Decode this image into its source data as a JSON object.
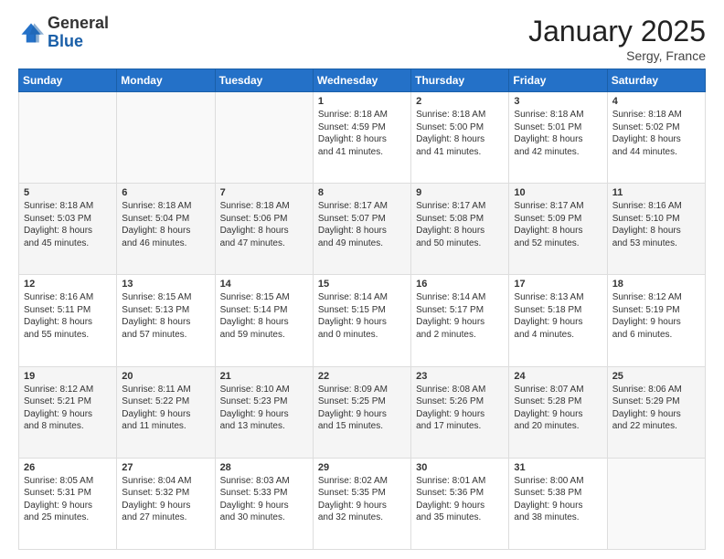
{
  "logo": {
    "general": "General",
    "blue": "Blue"
  },
  "header": {
    "month": "January 2025",
    "location": "Sergy, France"
  },
  "weekdays": [
    "Sunday",
    "Monday",
    "Tuesday",
    "Wednesday",
    "Thursday",
    "Friday",
    "Saturday"
  ],
  "weeks": [
    [
      {
        "day": "",
        "info": ""
      },
      {
        "day": "",
        "info": ""
      },
      {
        "day": "",
        "info": ""
      },
      {
        "day": "1",
        "info": "Sunrise: 8:18 AM\nSunset: 4:59 PM\nDaylight: 8 hours\nand 41 minutes."
      },
      {
        "day": "2",
        "info": "Sunrise: 8:18 AM\nSunset: 5:00 PM\nDaylight: 8 hours\nand 41 minutes."
      },
      {
        "day": "3",
        "info": "Sunrise: 8:18 AM\nSunset: 5:01 PM\nDaylight: 8 hours\nand 42 minutes."
      },
      {
        "day": "4",
        "info": "Sunrise: 8:18 AM\nSunset: 5:02 PM\nDaylight: 8 hours\nand 44 minutes."
      }
    ],
    [
      {
        "day": "5",
        "info": "Sunrise: 8:18 AM\nSunset: 5:03 PM\nDaylight: 8 hours\nand 45 minutes."
      },
      {
        "day": "6",
        "info": "Sunrise: 8:18 AM\nSunset: 5:04 PM\nDaylight: 8 hours\nand 46 minutes."
      },
      {
        "day": "7",
        "info": "Sunrise: 8:18 AM\nSunset: 5:06 PM\nDaylight: 8 hours\nand 47 minutes."
      },
      {
        "day": "8",
        "info": "Sunrise: 8:17 AM\nSunset: 5:07 PM\nDaylight: 8 hours\nand 49 minutes."
      },
      {
        "day": "9",
        "info": "Sunrise: 8:17 AM\nSunset: 5:08 PM\nDaylight: 8 hours\nand 50 minutes."
      },
      {
        "day": "10",
        "info": "Sunrise: 8:17 AM\nSunset: 5:09 PM\nDaylight: 8 hours\nand 52 minutes."
      },
      {
        "day": "11",
        "info": "Sunrise: 8:16 AM\nSunset: 5:10 PM\nDaylight: 8 hours\nand 53 minutes."
      }
    ],
    [
      {
        "day": "12",
        "info": "Sunrise: 8:16 AM\nSunset: 5:11 PM\nDaylight: 8 hours\nand 55 minutes."
      },
      {
        "day": "13",
        "info": "Sunrise: 8:15 AM\nSunset: 5:13 PM\nDaylight: 8 hours\nand 57 minutes."
      },
      {
        "day": "14",
        "info": "Sunrise: 8:15 AM\nSunset: 5:14 PM\nDaylight: 8 hours\nand 59 minutes."
      },
      {
        "day": "15",
        "info": "Sunrise: 8:14 AM\nSunset: 5:15 PM\nDaylight: 9 hours\nand 0 minutes."
      },
      {
        "day": "16",
        "info": "Sunrise: 8:14 AM\nSunset: 5:17 PM\nDaylight: 9 hours\nand 2 minutes."
      },
      {
        "day": "17",
        "info": "Sunrise: 8:13 AM\nSunset: 5:18 PM\nDaylight: 9 hours\nand 4 minutes."
      },
      {
        "day": "18",
        "info": "Sunrise: 8:12 AM\nSunset: 5:19 PM\nDaylight: 9 hours\nand 6 minutes."
      }
    ],
    [
      {
        "day": "19",
        "info": "Sunrise: 8:12 AM\nSunset: 5:21 PM\nDaylight: 9 hours\nand 8 minutes."
      },
      {
        "day": "20",
        "info": "Sunrise: 8:11 AM\nSunset: 5:22 PM\nDaylight: 9 hours\nand 11 minutes."
      },
      {
        "day": "21",
        "info": "Sunrise: 8:10 AM\nSunset: 5:23 PM\nDaylight: 9 hours\nand 13 minutes."
      },
      {
        "day": "22",
        "info": "Sunrise: 8:09 AM\nSunset: 5:25 PM\nDaylight: 9 hours\nand 15 minutes."
      },
      {
        "day": "23",
        "info": "Sunrise: 8:08 AM\nSunset: 5:26 PM\nDaylight: 9 hours\nand 17 minutes."
      },
      {
        "day": "24",
        "info": "Sunrise: 8:07 AM\nSunset: 5:28 PM\nDaylight: 9 hours\nand 20 minutes."
      },
      {
        "day": "25",
        "info": "Sunrise: 8:06 AM\nSunset: 5:29 PM\nDaylight: 9 hours\nand 22 minutes."
      }
    ],
    [
      {
        "day": "26",
        "info": "Sunrise: 8:05 AM\nSunset: 5:31 PM\nDaylight: 9 hours\nand 25 minutes."
      },
      {
        "day": "27",
        "info": "Sunrise: 8:04 AM\nSunset: 5:32 PM\nDaylight: 9 hours\nand 27 minutes."
      },
      {
        "day": "28",
        "info": "Sunrise: 8:03 AM\nSunset: 5:33 PM\nDaylight: 9 hours\nand 30 minutes."
      },
      {
        "day": "29",
        "info": "Sunrise: 8:02 AM\nSunset: 5:35 PM\nDaylight: 9 hours\nand 32 minutes."
      },
      {
        "day": "30",
        "info": "Sunrise: 8:01 AM\nSunset: 5:36 PM\nDaylight: 9 hours\nand 35 minutes."
      },
      {
        "day": "31",
        "info": "Sunrise: 8:00 AM\nSunset: 5:38 PM\nDaylight: 9 hours\nand 38 minutes."
      },
      {
        "day": "",
        "info": ""
      }
    ]
  ]
}
